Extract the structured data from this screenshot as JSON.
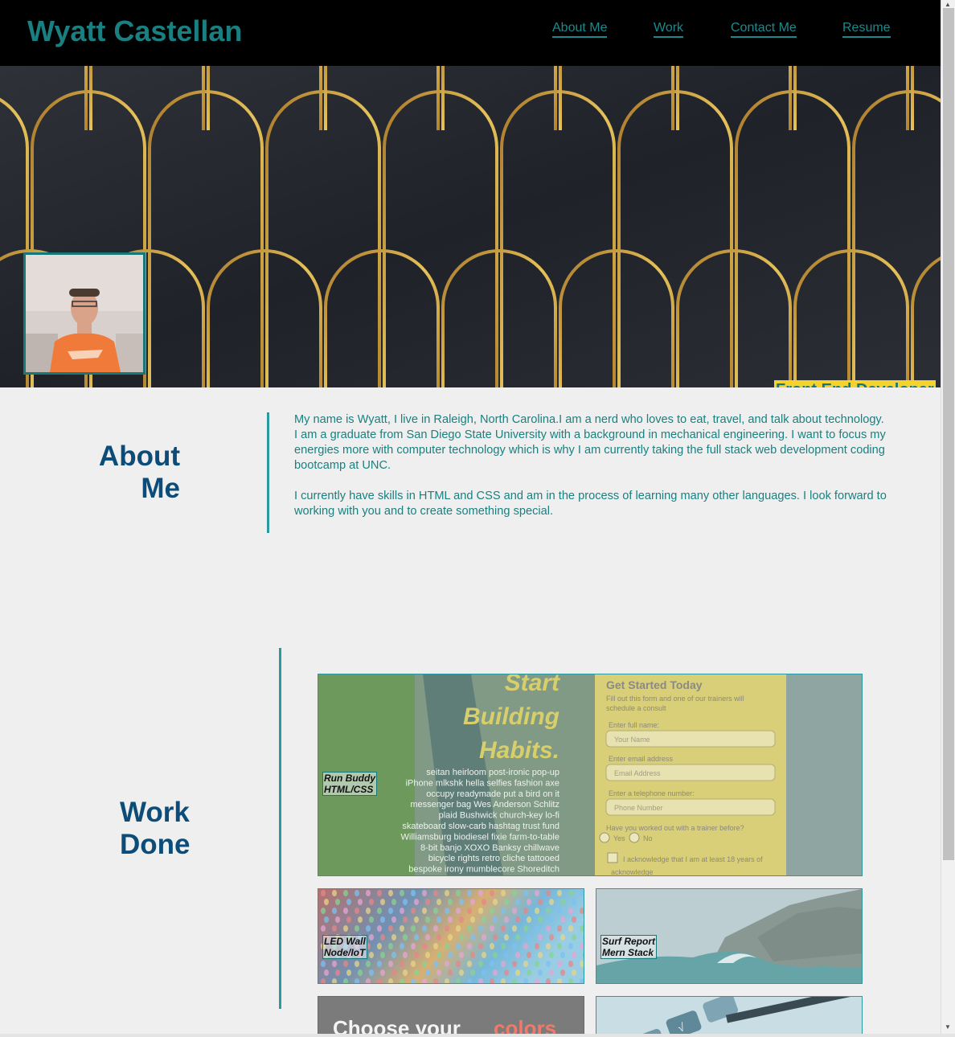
{
  "header": {
    "title": "Wyatt Castellan",
    "nav": [
      "About Me",
      "Work",
      "Contact Me",
      "Resume"
    ]
  },
  "hero": {
    "tagline": "Front End Developer"
  },
  "about": {
    "title_line1": "About",
    "title_line2": "Me",
    "para1": "My name is Wyatt, I live in Raleigh, North Carolina.I am a nerd who loves to eat, travel, and talk about technology.",
    "para2": "I am a graduate from San Diego State University with a background in mechanical engineering. I want to focus my energies more with computer technology which is why I am currently taking the full stack web development coding bootcamp at UNC.",
    "para3": "I currently have skills in HTML and CSS and am in the process of learning many other languages. I look forward to working with you and to create something special."
  },
  "work": {
    "title_line1": "Work",
    "title_line2": "Done",
    "projects": [
      {
        "name": "Run Buddy",
        "tech": "HTML/CSS"
      },
      {
        "name": "LED Wall",
        "tech": "Node/IoT"
      },
      {
        "name": "Surf Report",
        "tech": "Mern Stack"
      }
    ],
    "preview_runbuddy": {
      "headline": [
        "Start",
        "Building",
        "Habits."
      ],
      "filler": [
        "seitan heirloom post-ironic pop-up",
        "iPhone mlkshk hella selfies fashion axe",
        "occupy readymade put a bird on it",
        "messenger bag Wes Anderson Schlitz",
        "plaid Bushwick church-key lo-fi",
        "skateboard slow-carb hashtag trust fund",
        "Williamsburg biodiesel fixie farm-to-table",
        "8-bit banjo XOXO Banksy chillwave",
        "bicycle rights retro cliche tattooed",
        "bespoke irony mumblecore Shoreditch"
      ],
      "form_title": "Get Started Today",
      "form_sub1": "Fill out this form and one of our trainers will",
      "form_sub2": "schedule a consult",
      "label_name": "Enter full name:",
      "ph_name": "Your Name",
      "label_email": "Enter email address",
      "ph_email": "Email Address",
      "label_phone": "Enter a telephone number:",
      "ph_phone": "Phone Number",
      "question": "Have you worked out with a trainer before?",
      "yes": "Yes",
      "no": "No",
      "ack1": "I acknowledge that I am at least 18 years of",
      "ack2": "acknowledge"
    },
    "preview_colors": {
      "text_a": "Choose your",
      "text_b": "colors"
    }
  },
  "colors": {
    "teal": "#1a8080",
    "navy": "#0b4d78",
    "yellow": "#f4d32f",
    "gold": "#c89a2e"
  },
  "icons": [
    "scroll-up-arrow-icon",
    "scroll-down-arrow-icon"
  ]
}
